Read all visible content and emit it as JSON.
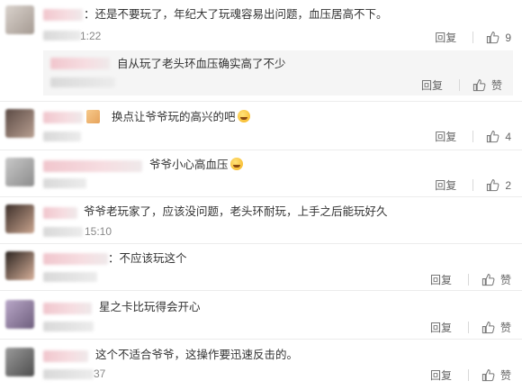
{
  "comments": [
    {
      "text": "：还是不要玩了，年纪大了玩魂容易出问题，血压居高不下。",
      "time": "1:22",
      "reply": "回复",
      "likes": "9"
    },
    {
      "text": "自从玩了老头环血压确实高了不少",
      "time": "",
      "reply": "回复",
      "likes": "赞"
    },
    {
      "text": "换点让爷爷玩的高兴的吧",
      "time": "",
      "reply": "回复",
      "likes": "4"
    },
    {
      "text": "爷爷小心高血压",
      "time": "",
      "reply": "回复",
      "likes": "2"
    },
    {
      "text": "爷爷老玩家了，应该没问题，老头环耐玩，上手之后能玩好久",
      "time": "15:10",
      "reply": "回复",
      "likes": "赞"
    },
    {
      "text": "：不应该玩这个",
      "time": "",
      "reply": "回复",
      "likes": "赞"
    },
    {
      "text": "星之卡比玩得会开心",
      "time": "",
      "reply": "回复",
      "likes": "赞"
    },
    {
      "text": "这个不适合爷爷，这操作要迅速反击的。",
      "time": "37",
      "reply": "回复",
      "likes": "赞"
    }
  ],
  "icons": {
    "like": "thumbs-up-icon",
    "emoji": "laughing-emoji-icon"
  }
}
